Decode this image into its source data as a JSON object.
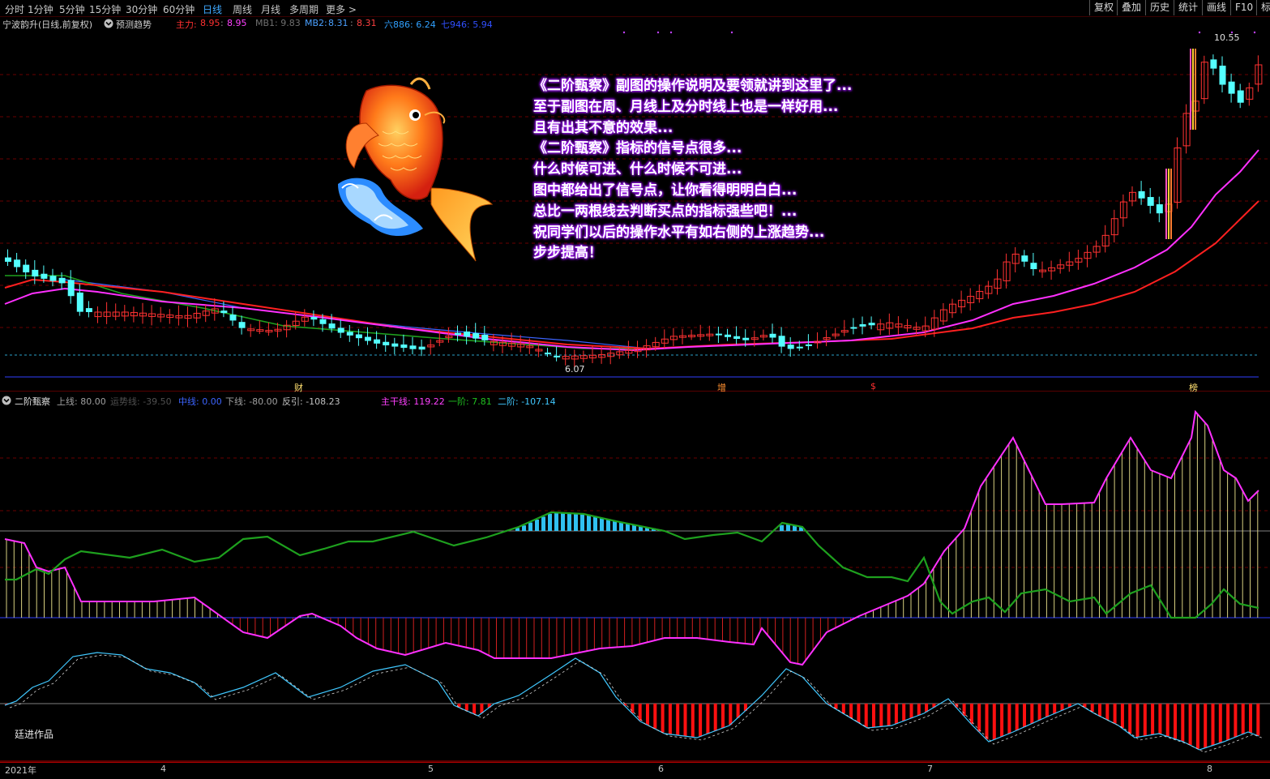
{
  "toolbar": {
    "timeframes": [
      "分时",
      "1分钟",
      "5分钟",
      "15分钟",
      "30分钟",
      "60分钟",
      "日线",
      "周线",
      "月线",
      "多周期",
      "更多 >"
    ],
    "active_timeframe": "日线",
    "right_buttons": [
      "复权",
      "叠加",
      "历史",
      "统计",
      "画线",
      "F10",
      "标"
    ]
  },
  "main_legend": {
    "stock_name": "宁波韵升(日线,前复权)",
    "predict_label": "预测趋势",
    "zhuli_label": "主力:",
    "zhuli_value1": "8.95",
    "zhuli_value2": "8.95",
    "mb1": "MB1: 9.83",
    "mb2_label": "MB2:",
    "mb2_value1": "8.31",
    "mb2_value2": "8.31",
    "liu": "六886: 6.24",
    "qi": "七946: 5.94"
  },
  "price_labels": {
    "high": "10.55",
    "low": "6.07"
  },
  "signal_labels": [
    "财",
    "增",
    "$",
    "榜"
  ],
  "annotation_lines": [
    "《二阶甄察》副图的操作说明及要领就讲到这里了...",
    "至于副图在周、月线上及分时线上也是一样好用...",
    "且有出其不意的效果...",
    "《二阶甄察》指标的信号点很多...",
    "什么时候可进、什么时候不可进...",
    "图中都给出了信号点，让你看得明明白白...",
    "总比一两根线去判断买点的指标强些吧！...",
    "祝同学们以后的操作水平有如右侧的上涨趋势...",
    "步步提高！"
  ],
  "sub_legend": {
    "indicator_name": "二阶甄察",
    "upper": "上线: 80.00",
    "trend": "运势线: -39.50",
    "middle": "中线: 0.00",
    "lower": "下线: -80.00",
    "reverse": "反引: -108.23",
    "main_line": "主干线: 119.22",
    "first_order": "一阶: 7.81",
    "second_order": "二阶: -107.14"
  },
  "author_label": "廷进作品",
  "x_axis": {
    "labels": [
      "2021年",
      "4",
      "5",
      "6",
      "7",
      "8"
    ]
  },
  "colors": {
    "up": "#ff3232",
    "down": "#54ffff",
    "ma_red": "#ff2020",
    "ma_magenta": "#ff30ff",
    "ma_green": "#1ea01e",
    "ma_blue": "#3c64ff",
    "annotation_glow": "#a020f0"
  },
  "icons": [
    "koi-fish-icon",
    "dropdown-circle-icon"
  ]
}
